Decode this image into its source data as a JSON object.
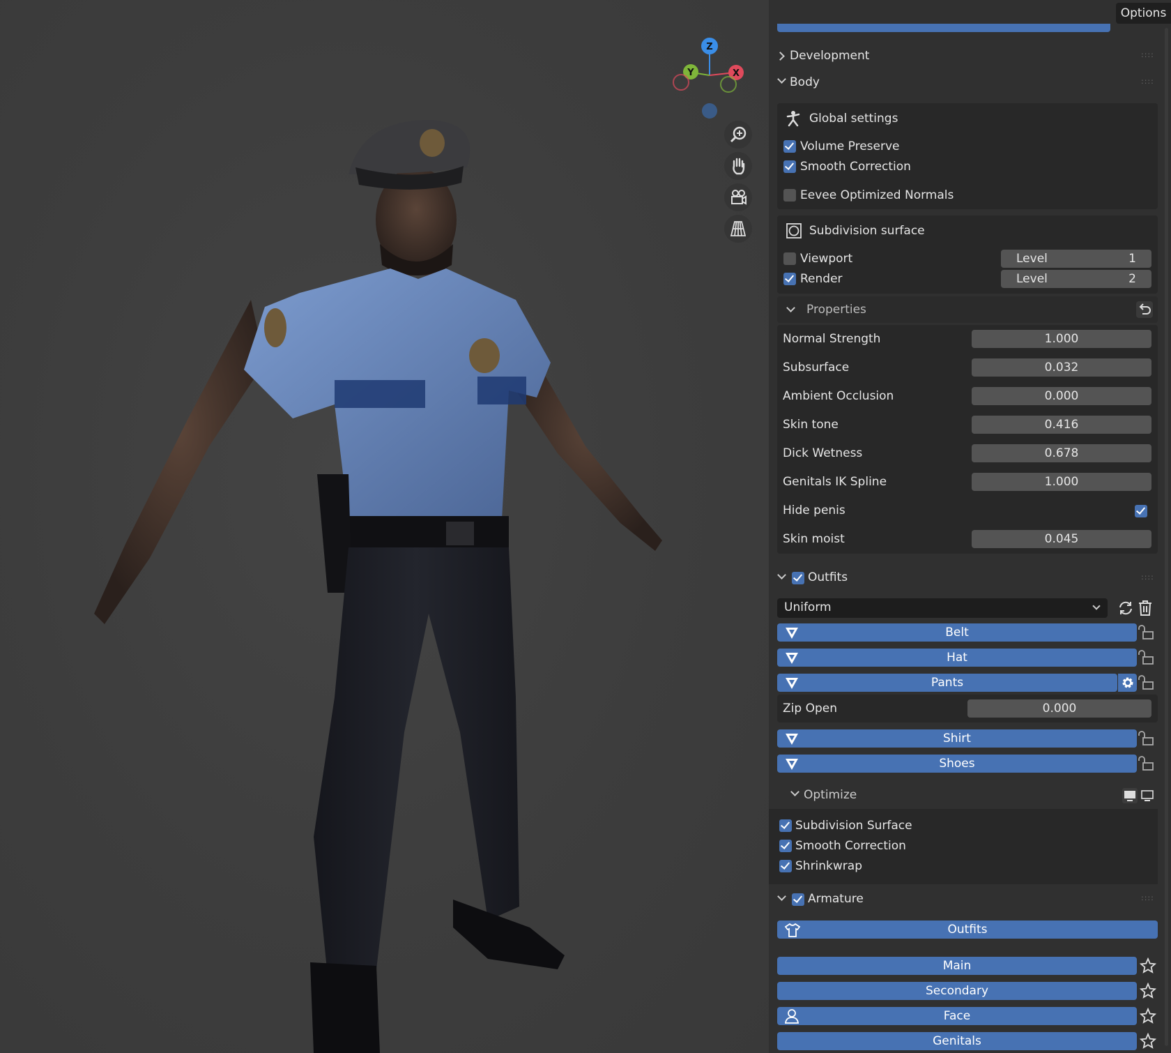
{
  "header": {
    "options_label": "Options"
  },
  "gizmo": {
    "z": "Z",
    "y": "Y",
    "x": "X"
  },
  "sections": {
    "development": "Development",
    "body": "Body",
    "outfits": "Outfits",
    "optimize": "Optimize",
    "armature": "Armature"
  },
  "global_settings": {
    "title": "Global settings",
    "volume_preserve": "Volume Preserve",
    "smooth_correction": "Smooth Correction",
    "eevee_normals": "Eevee Optimized Normals"
  },
  "subdivision": {
    "title": "Subdivision surface",
    "viewport_label": "Viewport",
    "render_label": "Render",
    "level_label": "Level",
    "viewport_level": "1",
    "render_level": "2"
  },
  "properties": {
    "title": "Properties",
    "rows": [
      {
        "label": "Normal Strength",
        "value": "1.000"
      },
      {
        "label": "Subsurface",
        "value": "0.032"
      },
      {
        "label": "Ambient Occlusion",
        "value": "0.000"
      },
      {
        "label": "Skin tone",
        "value": "0.416"
      },
      {
        "label": "Dick Wetness",
        "value": "0.678"
      },
      {
        "label": "Genitals IK Spline",
        "value": "1.000"
      }
    ],
    "hide_penis": "Hide penis",
    "skin_moist_label": "Skin moist",
    "skin_moist_value": "0.045"
  },
  "outfits": {
    "selected": "Uniform",
    "items": [
      "Belt",
      "Hat",
      "Pants",
      "Shirt",
      "Shoes"
    ],
    "zip_label": "Zip Open",
    "zip_value": "0.000"
  },
  "optimize": {
    "subdivision_surface": "Subdivision Surface",
    "smooth_correction": "Smooth Correction",
    "shrinkwrap": "Shrinkwrap"
  },
  "armature": {
    "outfits_button": "Outfits",
    "main": "Main",
    "secondary": "Secondary",
    "face": "Face",
    "genitals": "Genitals"
  },
  "colors": {
    "accent": "#4772b3",
    "panel": "#303030",
    "box": "#282828",
    "field": "#545454"
  }
}
